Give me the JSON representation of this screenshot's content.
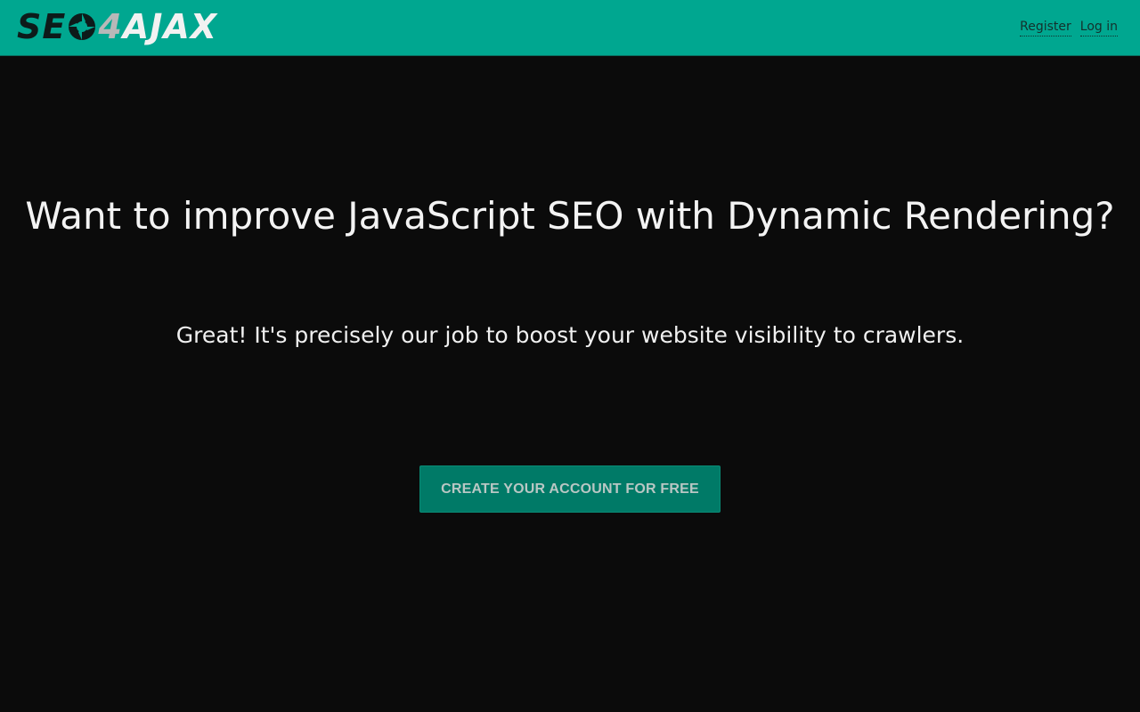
{
  "header": {
    "logo": {
      "part1": "SE",
      "part2": "4",
      "part3": "AJAX"
    },
    "nav": {
      "register": "Register",
      "login": "Log in"
    }
  },
  "hero": {
    "title": "Want to improve JavaScript SEO with Dynamic Rendering?",
    "subtitle": "Great! It's precisely our job to boost your website visibility to crawlers.",
    "cta_label": "Create your account for free"
  },
  "colors": {
    "header_bg": "#00a790",
    "page_bg": "#0b0b0b",
    "cta_bg": "#007a67"
  }
}
